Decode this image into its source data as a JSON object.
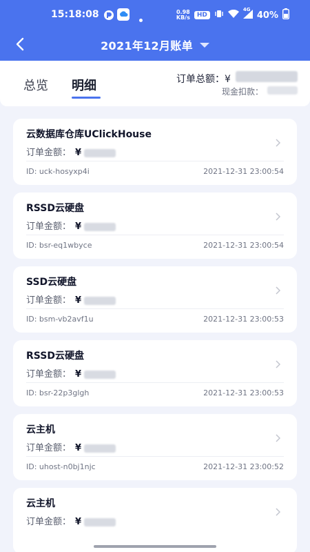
{
  "status_bar": {
    "time": "15:18:08",
    "net_speed": "0.98\nKB/s",
    "hd": "HD",
    "signal": "4G",
    "battery": "40%"
  },
  "nav": {
    "title": "2021年12月账单"
  },
  "summary": {
    "tabs": [
      "总览",
      "明细"
    ],
    "active_tab": "明细",
    "total_label": "订单总额：",
    "total_currency": "¥",
    "cash_label": "现金扣款："
  },
  "cards": [
    {
      "title": "云数据库仓库UClickHouse",
      "amount_label": "订单金额：",
      "currency": "¥",
      "id": "ID: uck-hosyxp4i",
      "time": "2021-12-31 23:00:54"
    },
    {
      "title": "RSSD云硬盘",
      "amount_label": "订单金额：",
      "currency": "¥",
      "id": "ID: bsr-eq1wbyce",
      "time": "2021-12-31 23:00:54"
    },
    {
      "title": "SSD云硬盘",
      "amount_label": "订单金额：",
      "currency": "¥",
      "id": "ID: bsm-vb2avf1u",
      "time": "2021-12-31 23:00:53"
    },
    {
      "title": "RSSD云硬盘",
      "amount_label": "订单金额：",
      "currency": "¥",
      "id": "ID: bsr-22p3glgh",
      "time": "2021-12-31 23:00:53"
    },
    {
      "title": "云主机",
      "amount_label": "订单金额：",
      "currency": "¥",
      "id": "ID: uhost-n0bj1njc",
      "time": "2021-12-31 23:00:52"
    },
    {
      "title": "云主机",
      "amount_label": "订单金额：",
      "currency": "¥",
      "id": "",
      "time": ""
    }
  ],
  "colors": {
    "primary": "#4a73ee",
    "background": "#f1f3fb"
  }
}
